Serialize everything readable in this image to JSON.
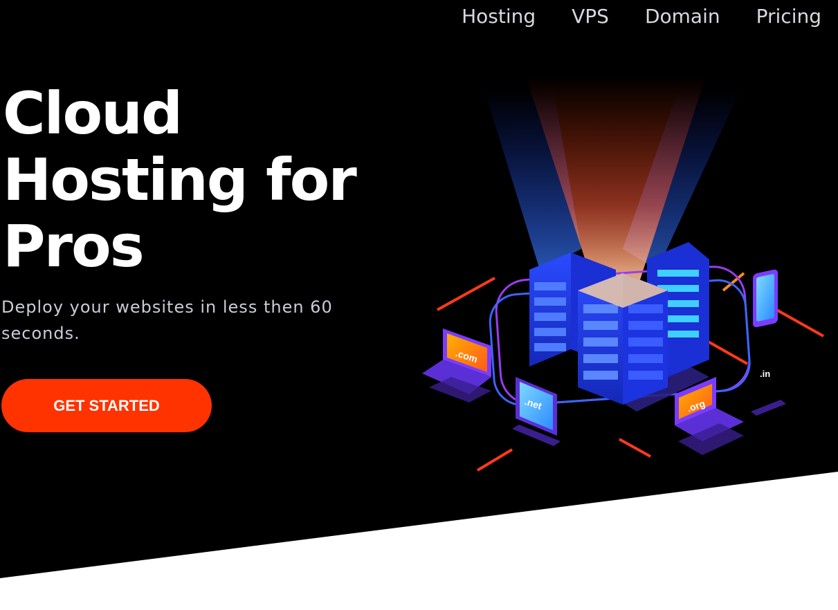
{
  "nav": {
    "items": [
      {
        "label": "Hosting"
      },
      {
        "label": "VPS"
      },
      {
        "label": "Domain"
      },
      {
        "label": "Pricing"
      }
    ]
  },
  "hero": {
    "headline": "Cloud Hosting for Pros",
    "subtitle": "Deploy your websites in less then 60 seconds.",
    "cta_label": "GET STARTED"
  },
  "illustration": {
    "domains": [
      ".com",
      ".net",
      ".org",
      ".in"
    ]
  },
  "colors": {
    "background": "#000000",
    "accent": "#ff3300",
    "text": "#ffffff",
    "nav_text": "#d9d9de",
    "server_blue": "#1f3dff",
    "ring_purple": "#9b3cf0"
  }
}
